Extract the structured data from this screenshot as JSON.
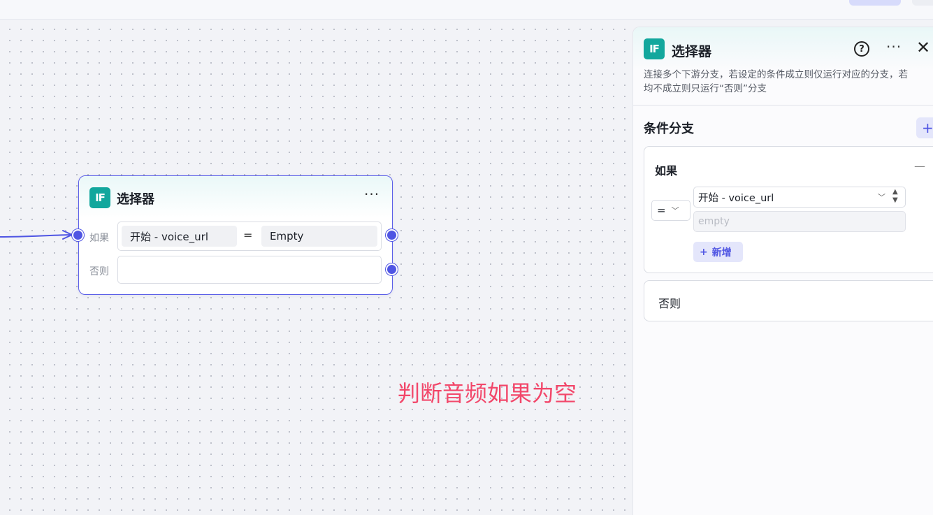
{
  "node": {
    "title": "选择器",
    "icon": "IF",
    "more": "···",
    "if_label": "如果",
    "else_label": "否则",
    "condition": {
      "variable": "开始  -  voice_url",
      "operator": "=",
      "value": "Empty"
    }
  },
  "annotation": "判断音频如果为空",
  "panel": {
    "icon": "IF",
    "title": "选择器",
    "help": "?",
    "more": "···",
    "close": "✕",
    "description_line1": "连接多个下游分支，若设定的条件成立则仅运行对应的分支，若",
    "description_line2": "均不成立则只运行“否则”分支",
    "section_title": "条件分支",
    "add_branch": "+",
    "if_card": {
      "label": "如果",
      "collapse": "—",
      "operator": "=",
      "variable": "开始 - voice_url",
      "value_placeholder": "empty",
      "add_label": "新增",
      "add_icon": "+"
    },
    "else_card": {
      "label": "否则"
    }
  },
  "colors": {
    "accent": "#4f55e3",
    "icon_teal": "#12a79d",
    "annotation_red": "#f2476a"
  }
}
